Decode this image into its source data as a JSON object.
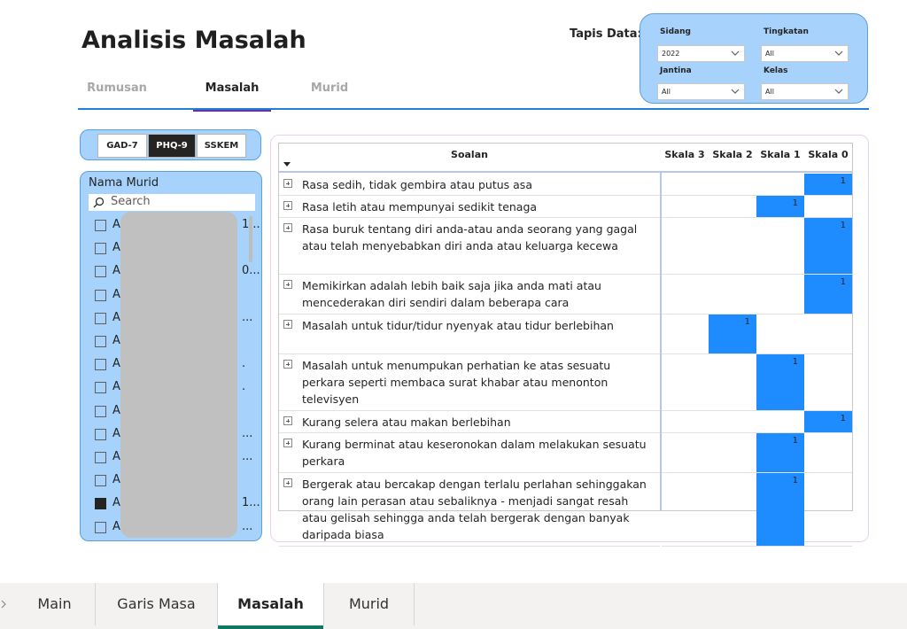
{
  "page_title": "Analisis Masalah",
  "nav_tabs": [
    {
      "label": "Rumusan",
      "active": false
    },
    {
      "label": "Masalah",
      "active": true
    },
    {
      "label": "Murid",
      "active": false
    }
  ],
  "filters": {
    "label": "Tapis Data:",
    "sidang": {
      "label": "Sidang",
      "value": "2022"
    },
    "tingkatan": {
      "label": "Tingkatan",
      "value": "All"
    },
    "jantina": {
      "label": "Jantina",
      "value": "All"
    },
    "kelas": {
      "label": "Kelas",
      "value": "All"
    }
  },
  "instrument_toggle": [
    {
      "label": "GAD-7",
      "active": false
    },
    {
      "label": "PHQ-9",
      "active": true
    },
    {
      "label": "SSKEM",
      "active": false
    }
  ],
  "slicer": {
    "title": "Nama Murid",
    "search_placeholder": "Search",
    "items": [
      {
        "letter": "A",
        "tail": "1...",
        "checked": false
      },
      {
        "letter": "A",
        "tail": "",
        "checked": false
      },
      {
        "letter": "A",
        "tail": "0...",
        "checked": false
      },
      {
        "letter": "A",
        "tail": "",
        "checked": false
      },
      {
        "letter": "A",
        "tail": "...",
        "checked": false
      },
      {
        "letter": "A",
        "tail": "",
        "checked": false
      },
      {
        "letter": "A",
        "tail": ".",
        "checked": false
      },
      {
        "letter": "A",
        "tail": ".",
        "checked": false
      },
      {
        "letter": "A",
        "tail": "",
        "checked": false
      },
      {
        "letter": "A",
        "tail": "...",
        "checked": false
      },
      {
        "letter": "A",
        "tail": "...",
        "checked": false
      },
      {
        "letter": "A",
        "tail": "",
        "checked": false
      },
      {
        "letter": "A",
        "tail": "1...",
        "checked": true
      },
      {
        "letter": "A",
        "tail": "...",
        "checked": false
      }
    ]
  },
  "matrix": {
    "question_header": "Soalan",
    "scale_headers": [
      "Skala 3",
      "Skala 2",
      "Skala 1",
      "Skala 0"
    ],
    "rows": [
      {
        "text": "Rasa sedih, tidak gembira atau putus asa",
        "scale": "Skala 0",
        "value": "1"
      },
      {
        "text": "Rasa letih atau mempunyai sedikit tenaga",
        "scale": "Skala 1",
        "value": "1"
      },
      {
        "text": "Rasa buruk tentang diri anda-atau anda seorang yang gagal atau telah menyebabkan diri anda atau keluarga kecewa",
        "scale": "Skala 0",
        "value": "1"
      },
      {
        "text": "Memikirkan adalah lebih baik saja jika anda mati atau mencederakan diri sendiri dalam beberapa cara",
        "scale": "Skala 0",
        "value": "1"
      },
      {
        "text": "Masalah untuk tidur/tidur nyenyak atau tidur berlebihan",
        "scale": "Skala 2",
        "value": "1"
      },
      {
        "text": "Masalah untuk menumpukan perhatian ke atas sesuatu perkara seperti membaca surat khabar atau menonton televisyen",
        "scale": "Skala 1",
        "value": "1"
      },
      {
        "text": "Kurang selera atau makan berlebihan",
        "scale": "Skala 0",
        "value": "1"
      },
      {
        "text": "Kurang berminat atau keseronokan dalam melakukan sesuatu perkara",
        "scale": "Skala 1",
        "value": "1"
      },
      {
        "text": "Bergerak atau bercakap dengan terlalu perlahan sehinggakan orang lain perasan atau sebaliknya - menjadi sangat resah atau gelisah sehingga anda telah bergerak dengan banyak daripada biasa",
        "scale": "Skala 1",
        "value": "1"
      }
    ]
  },
  "bottom_tabs": [
    {
      "label": "Main",
      "active": false
    },
    {
      "label": "Garis Masa",
      "active": false
    },
    {
      "label": "Masalah",
      "active": true
    },
    {
      "label": "Murid",
      "active": false
    }
  ],
  "colors": {
    "highlight_cell": "#1e8cff",
    "panel_bg": "#a6d2fb",
    "nav_underline": "#6b2fa0",
    "tab_underline": "#117865"
  }
}
